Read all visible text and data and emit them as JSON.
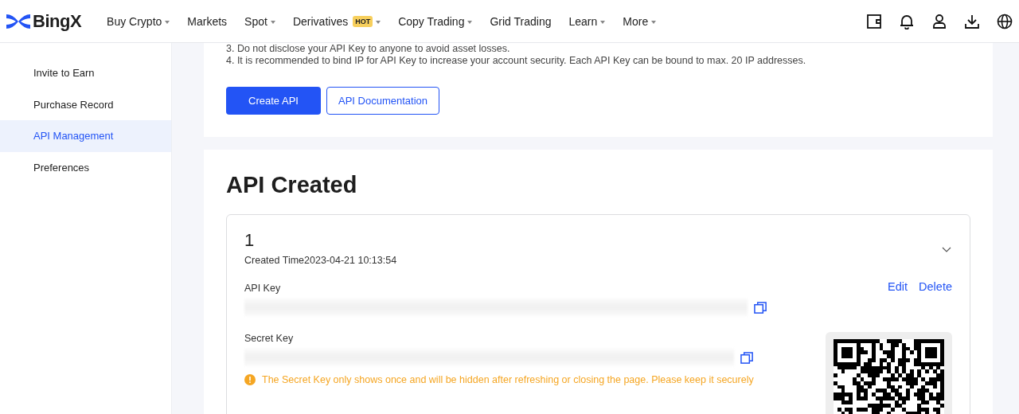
{
  "header": {
    "logo": "BingX",
    "nav": [
      {
        "label": "Buy Crypto",
        "dropdown": true
      },
      {
        "label": "Markets",
        "dropdown": false
      },
      {
        "label": "Spot",
        "dropdown": true
      },
      {
        "label": "Derivatives",
        "badge": "HOT",
        "dropdown": true
      },
      {
        "label": "Copy Trading",
        "dropdown": true
      },
      {
        "label": "Grid Trading",
        "dropdown": false
      },
      {
        "label": "Learn",
        "dropdown": true
      },
      {
        "label": "More",
        "dropdown": true
      }
    ]
  },
  "sidebar": {
    "items": [
      {
        "label": "Invite to Earn",
        "selected": false
      },
      {
        "label": "Purchase Record",
        "selected": false
      },
      {
        "label": "API Management",
        "selected": true
      },
      {
        "label": "Preferences",
        "selected": false
      }
    ]
  },
  "notes": [
    "3. Do not disclose your API Key to anyone to avoid asset losses.",
    "4. It is recommended to bind IP for API Key to increase your account security. Each API Key can be bound to max. 20 IP addresses."
  ],
  "actions": [
    {
      "label": "Create API",
      "kind": "primary"
    },
    {
      "label": "API Documentation",
      "kind": "outline"
    }
  ],
  "api_created": {
    "title": "API Created",
    "entries": [
      {
        "index": "1",
        "created_time": "Created Time2023-04-21 10:13:54",
        "expanded": true,
        "api_key_label": "API Key",
        "secret_key_label": "Secret Key",
        "warning": "The Secret Key only shows once and will be hidden after refreshing or closing the page. Please keep it securely",
        "links": [
          "Edit",
          "Delete"
        ]
      }
    ]
  }
}
